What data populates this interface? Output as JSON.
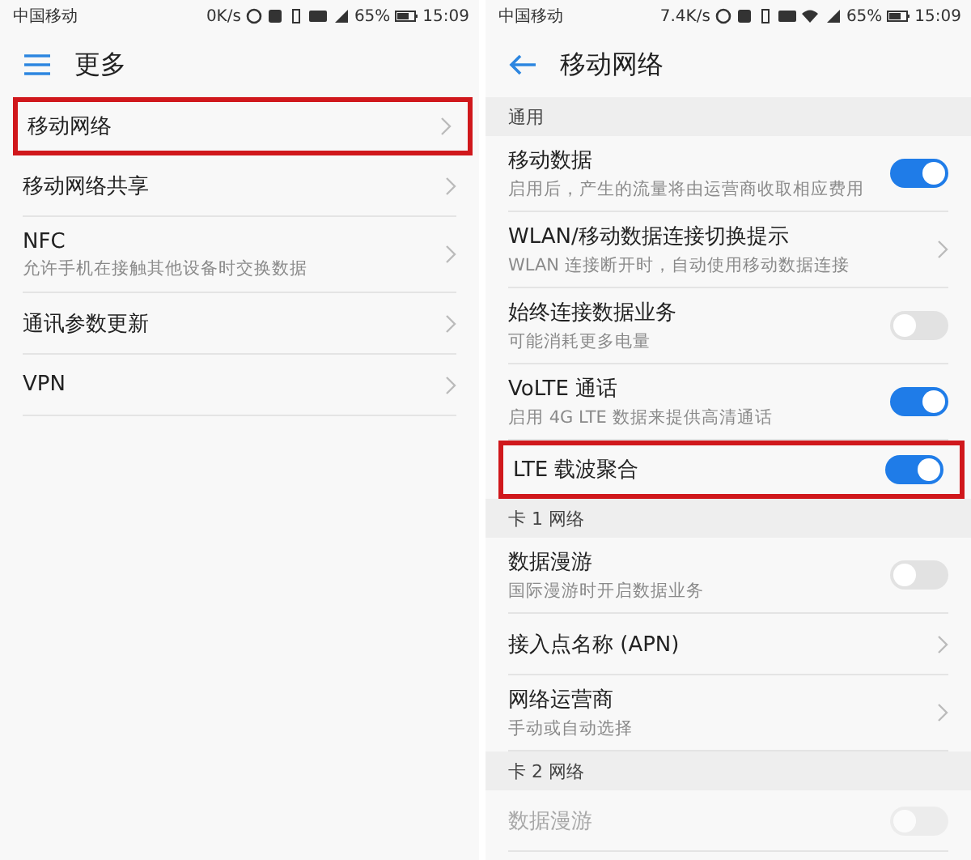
{
  "screens": [
    {
      "status_bar": {
        "carrier": "中国移动",
        "speed": "0K/s",
        "wifi": false,
        "battery": "65%",
        "time": "15:09"
      },
      "header": {
        "kind": "menu",
        "title": "更多"
      },
      "sections": [
        {
          "items": [
            {
              "kind": "link",
              "title": "移动网络",
              "highlighted": true
            },
            {
              "kind": "link",
              "title": "移动网络共享",
              "highlighted": false
            },
            {
              "kind": "link",
              "title": "NFC",
              "subtitle": "允许手机在接触其他设备时交换数据",
              "highlighted": false
            },
            {
              "kind": "link",
              "title": "通讯参数更新",
              "highlighted": false
            },
            {
              "kind": "link",
              "title": "VPN",
              "highlighted": false
            }
          ]
        }
      ]
    },
    {
      "status_bar": {
        "carrier": "中国移动",
        "speed": "7.4K/s",
        "wifi": true,
        "battery": "65%",
        "time": "15:09"
      },
      "header": {
        "kind": "back",
        "title": "移动网络"
      },
      "sections": [
        {
          "heading": "通用",
          "items": [
            {
              "kind": "toggle",
              "title": "移动数据",
              "subtitle": "启用后，产生的流量将由运营商收取相应费用",
              "on": true,
              "disabled": false,
              "highlighted": false
            },
            {
              "kind": "link",
              "title": "WLAN/移动数据连接切换提示",
              "subtitle": "WLAN 连接断开时，自动使用移动数据连接",
              "highlighted": false
            },
            {
              "kind": "toggle",
              "title": "始终连接数据业务",
              "subtitle": "可能消耗更多电量",
              "on": false,
              "disabled": false,
              "highlighted": false
            },
            {
              "kind": "toggle",
              "title": "VoLTE 通话",
              "subtitle": "启用 4G LTE 数据来提供高清通话",
              "on": true,
              "disabled": false,
              "highlighted": false
            },
            {
              "kind": "toggle",
              "title": "LTE 载波聚合",
              "on": true,
              "disabled": false,
              "highlighted": true
            }
          ]
        },
        {
          "heading": "卡 1 网络",
          "items": [
            {
              "kind": "toggle",
              "title": "数据漫游",
              "subtitle": "国际漫游时开启数据业务",
              "on": false,
              "disabled": false,
              "highlighted": false
            },
            {
              "kind": "link",
              "title": "接入点名称 (APN)",
              "highlighted": false
            },
            {
              "kind": "link",
              "title": "网络运营商",
              "subtitle": "手动或自动选择",
              "highlighted": false
            }
          ]
        },
        {
          "heading": "卡 2 网络",
          "items": [
            {
              "kind": "toggle",
              "title": "数据漫游",
              "on": false,
              "disabled": true,
              "highlighted": false
            }
          ]
        }
      ]
    }
  ]
}
